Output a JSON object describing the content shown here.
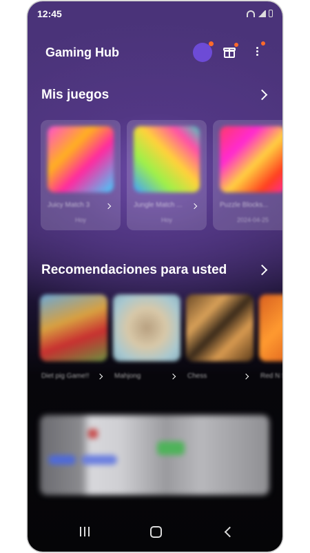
{
  "status_bar": {
    "time": "12:45",
    "icons": [
      "wifi-icon",
      "signal-icon",
      "battery-icon"
    ]
  },
  "header": {
    "title": "Gaming Hub",
    "icons": [
      "avatar",
      "gift-icon",
      "more-vert-icon"
    ]
  },
  "my_games": {
    "title": "Mis juegos",
    "items": [
      {
        "name": "Juicy Match 3",
        "date": "Hoy"
      },
      {
        "name": "Jungle Match ...",
        "date": "Hoy"
      },
      {
        "name": "Puzzle Blocks...",
        "date": "2024-04-25"
      }
    ]
  },
  "recommendations": {
    "title": "Recomendaciones para usted",
    "items": [
      {
        "name": "Diet pig Game!!"
      },
      {
        "name": "Mahjong"
      },
      {
        "name": "Chess"
      },
      {
        "name": "Red N Speed"
      }
    ]
  },
  "nav_bar": {
    "icons": [
      "recent-apps-icon",
      "home-icon",
      "back-icon"
    ]
  },
  "colors": {
    "background_top": "#4b3479",
    "accent_dot": "#ff6a2a",
    "avatar": "#6d4bd6"
  }
}
